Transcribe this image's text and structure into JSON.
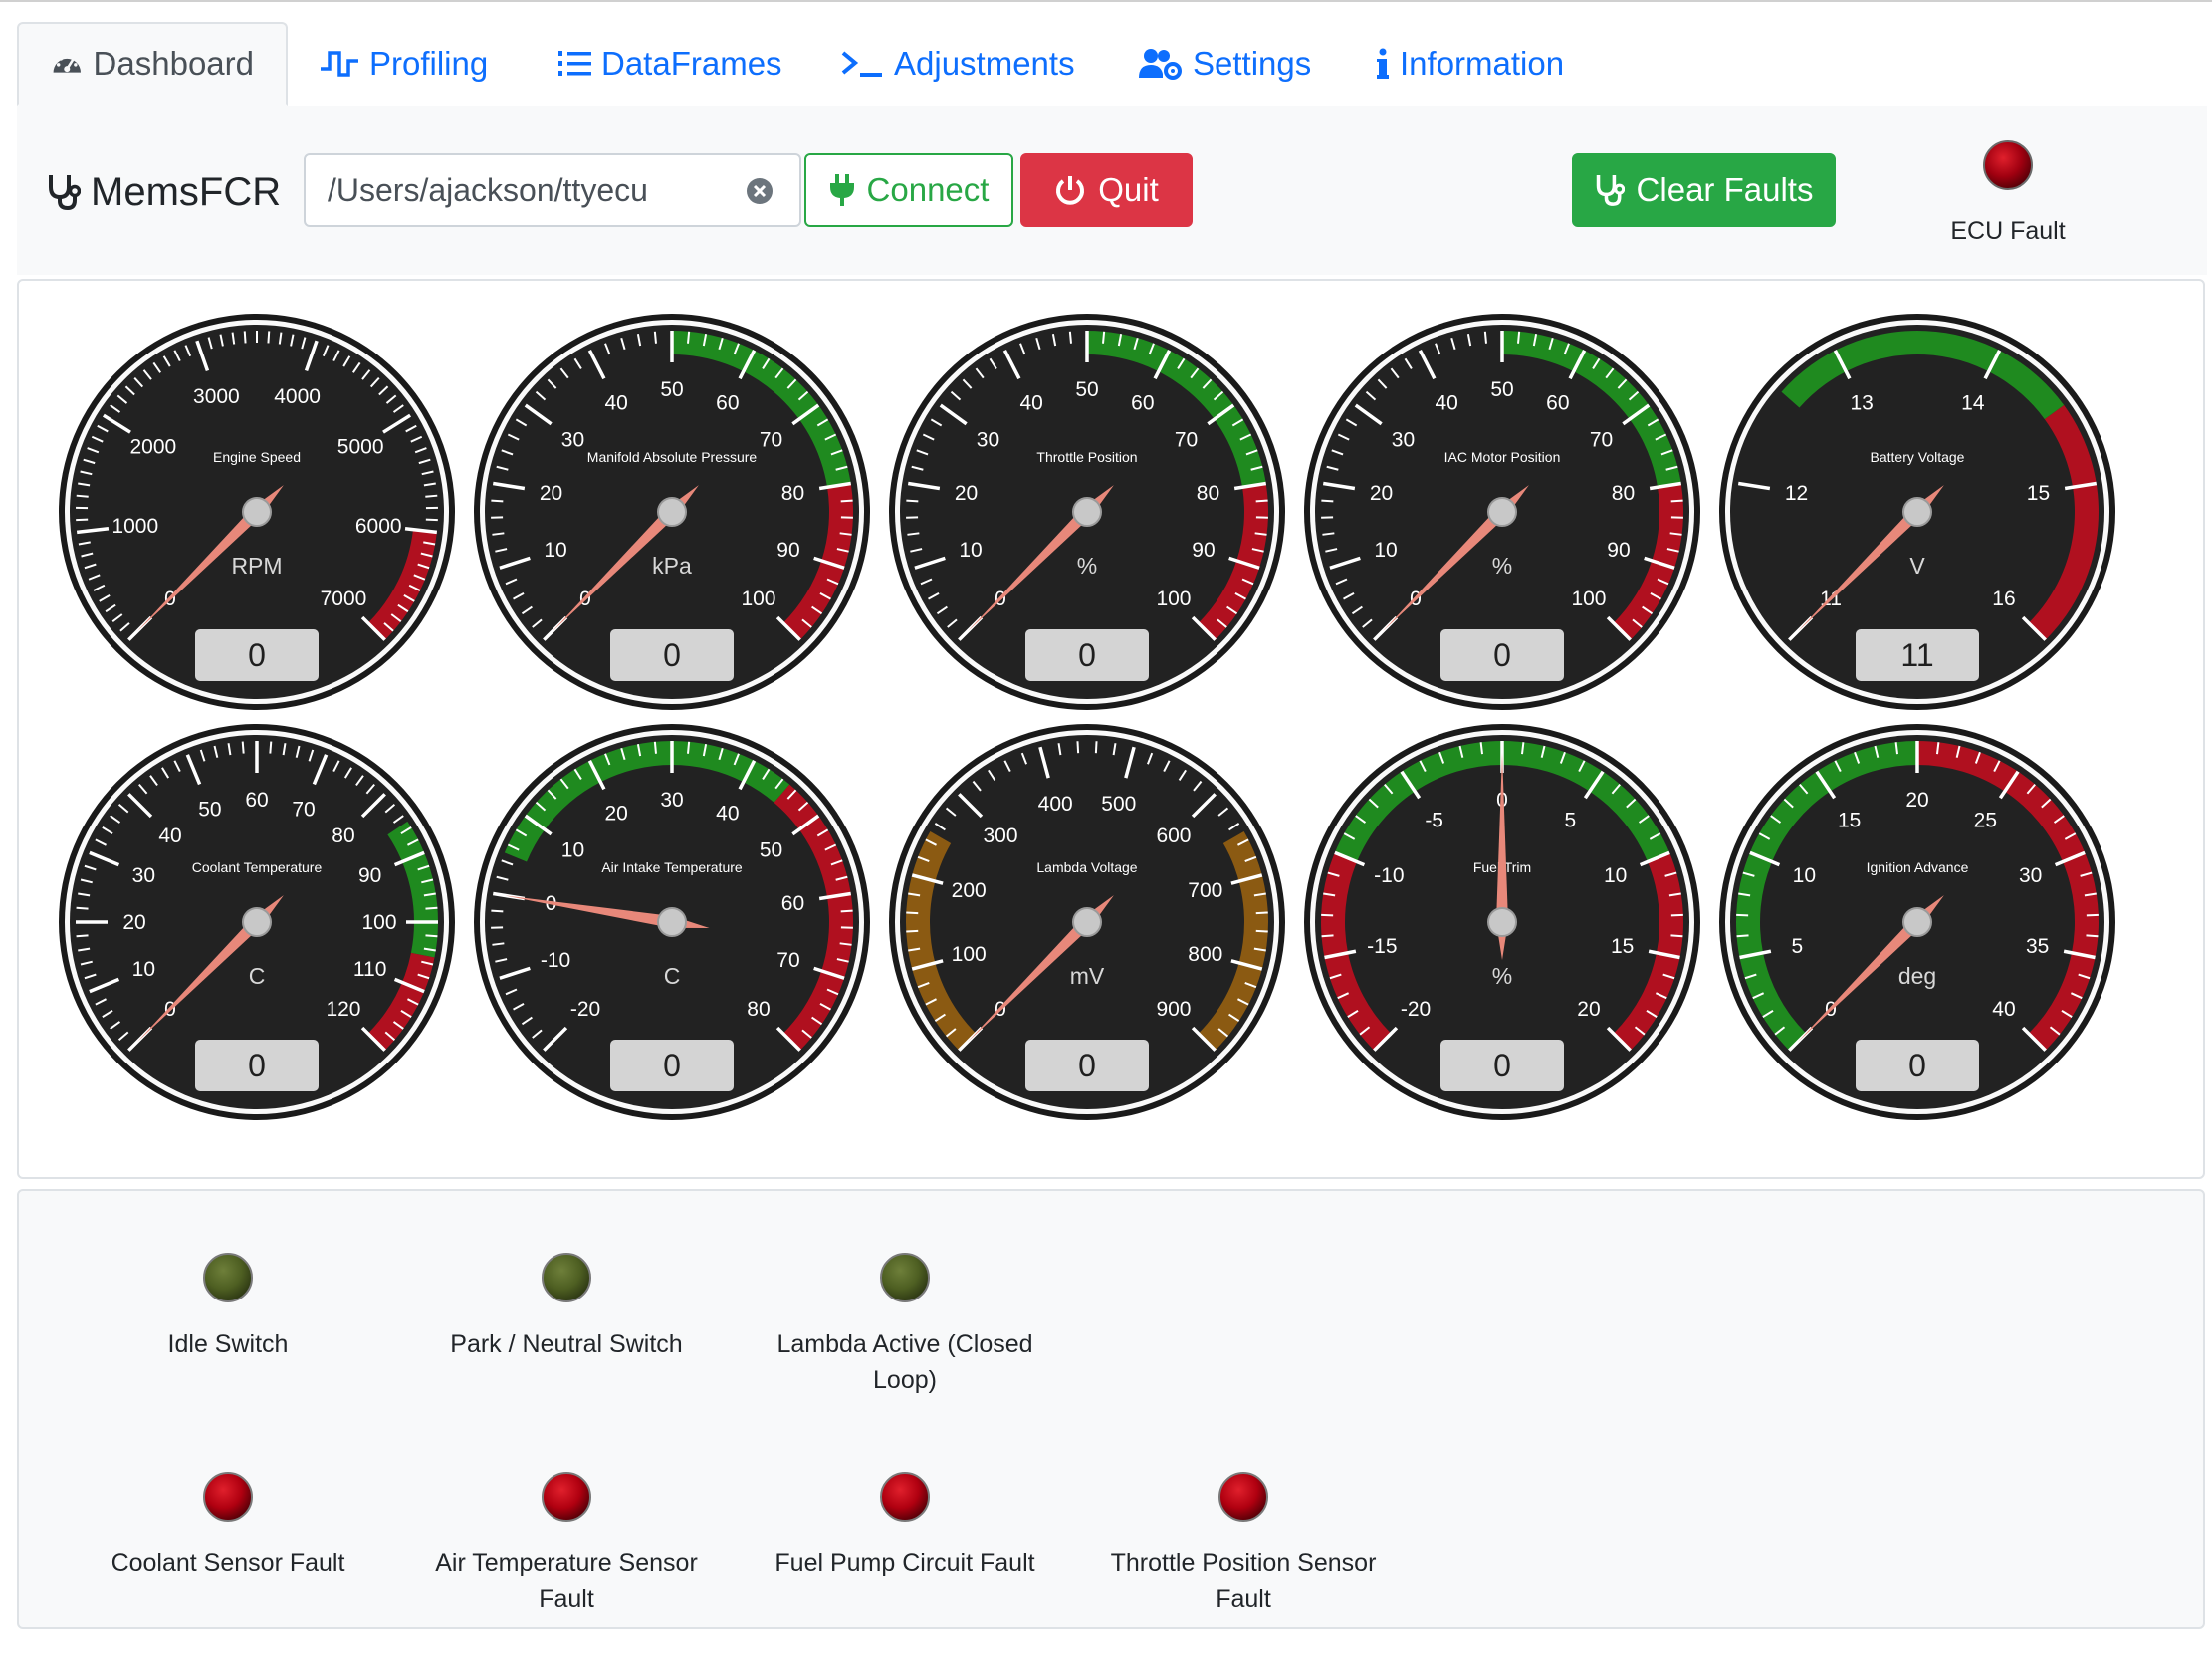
{
  "tabs": [
    {
      "label": "Dashboard",
      "icon": "speedometer-icon",
      "active": true
    },
    {
      "label": "Profiling",
      "icon": "pulse-icon",
      "active": false
    },
    {
      "label": "DataFrames",
      "icon": "list-ol-icon",
      "active": false
    },
    {
      "label": "Adjustments",
      "icon": "terminal-icon",
      "active": false
    },
    {
      "label": "Settings",
      "icon": "users-gear-icon",
      "active": false
    },
    {
      "label": "Information",
      "icon": "info-icon",
      "active": false
    }
  ],
  "toolbar": {
    "brand": "MemsFCR",
    "port_value": "/Users/ajackson/ttyecu",
    "connect_label": "Connect",
    "quit_label": "Quit",
    "clear_faults_label": "Clear Faults",
    "ecu_fault_label": "ECU Fault"
  },
  "colors": {
    "primary": "#0d6efd",
    "success": "#28a745",
    "danger": "#dc3545",
    "gauge_face": "#222222",
    "green_band": "#1f8a1f",
    "red_band": "#b0101f",
    "amber_band": "#8b5a12",
    "needle": "#e8887a",
    "led_red": "#b00010",
    "led_olive": "#4e5f22"
  },
  "gauges": [
    {
      "title": "Engine Speed",
      "unit": "RPM",
      "min": 0,
      "max": 7000,
      "value": 0,
      "display": "0",
      "labels": [
        "0",
        "1000",
        "2000",
        "3000",
        "4000",
        "5000",
        "6000",
        "7000"
      ],
      "minor": 10,
      "bands": [
        {
          "from": 6000,
          "to": 7000,
          "color": "red"
        }
      ]
    },
    {
      "title": "Manifold Absolute Pressure",
      "unit": "kPa",
      "min": 0,
      "max": 100,
      "value": 0,
      "display": "0",
      "labels": [
        "0",
        "10",
        "20",
        "30",
        "40",
        "50",
        "60",
        "70",
        "80",
        "90",
        "100"
      ],
      "minor": 5,
      "bands": [
        {
          "from": 50,
          "to": 80,
          "color": "green"
        },
        {
          "from": 80,
          "to": 100,
          "color": "red"
        }
      ]
    },
    {
      "title": "Throttle Position",
      "unit": "%",
      "min": 0,
      "max": 100,
      "value": 0,
      "display": "0",
      "labels": [
        "0",
        "10",
        "20",
        "30",
        "40",
        "50",
        "60",
        "70",
        "80",
        "90",
        "100"
      ],
      "minor": 5,
      "bands": [
        {
          "from": 50,
          "to": 80,
          "color": "green"
        },
        {
          "from": 80,
          "to": 100,
          "color": "red"
        }
      ]
    },
    {
      "title": "IAC Motor Position",
      "unit": "%",
      "min": 0,
      "max": 100,
      "value": 0,
      "display": "0",
      "labels": [
        "0",
        "10",
        "20",
        "30",
        "40",
        "50",
        "60",
        "70",
        "80",
        "90",
        "100"
      ],
      "minor": 5,
      "bands": [
        {
          "from": 50,
          "to": 80,
          "color": "green"
        },
        {
          "from": 80,
          "to": 100,
          "color": "red"
        }
      ]
    },
    {
      "title": "Battery Voltage",
      "unit": "V",
      "min": 11,
      "max": 16,
      "value": 11,
      "display": "11",
      "labels": [
        "11",
        "12",
        "13",
        "14",
        "15",
        "16"
      ],
      "minor": 0,
      "bands": [
        {
          "from": 12.6,
          "to": 14.5,
          "color": "green"
        },
        {
          "from": 14.5,
          "to": 16,
          "color": "red"
        }
      ]
    },
    {
      "title": "Coolant Temperature",
      "unit": "C",
      "min": 0,
      "max": 120,
      "value": 0,
      "display": "0",
      "labels": [
        "0",
        "10",
        "20",
        "30",
        "40",
        "50",
        "60",
        "70",
        "80",
        "90",
        "100",
        "110",
        "120"
      ],
      "minor": 5,
      "bands": [
        {
          "from": 85,
          "to": 105,
          "color": "green"
        },
        {
          "from": 105,
          "to": 120,
          "color": "red"
        }
      ]
    },
    {
      "title": "Air Intake Temperature",
      "unit": "C",
      "min": -20,
      "max": 80,
      "value": 0,
      "display": "0",
      "labels": [
        "-20",
        "-10",
        "0",
        "10",
        "20",
        "30",
        "40",
        "50",
        "60",
        "70",
        "80"
      ],
      "minor": 5,
      "bands": [
        {
          "from": 5,
          "to": 45,
          "color": "green"
        },
        {
          "from": 45,
          "to": 80,
          "color": "red"
        }
      ]
    },
    {
      "title": "Lambda Voltage",
      "unit": "mV",
      "min": 0,
      "max": 900,
      "value": 0,
      "display": "0",
      "labels": [
        "0",
        "100",
        "200",
        "300",
        "400",
        "500",
        "600",
        "700",
        "800",
        "900"
      ],
      "minor": 5,
      "bands": [
        {
          "from": 0,
          "to": 250,
          "color": "amber"
        },
        {
          "from": 650,
          "to": 900,
          "color": "amber"
        }
      ]
    },
    {
      "title": "Fuel Trim",
      "unit": "%",
      "min": -20,
      "max": 20,
      "value": 0,
      "display": "0",
      "labels": [
        "-20",
        "-15",
        "-10",
        "-5",
        "0",
        "5",
        "10",
        "15",
        "20"
      ],
      "minor": 5,
      "bands": [
        {
          "from": -20,
          "to": -10,
          "color": "red"
        },
        {
          "from": -10,
          "to": 10,
          "color": "green"
        },
        {
          "from": 10,
          "to": 20,
          "color": "red"
        }
      ]
    },
    {
      "title": "Ignition Advance",
      "unit": "deg",
      "min": 0,
      "max": 40,
      "value": 0,
      "display": "0",
      "labels": [
        "0",
        "5",
        "10",
        "15",
        "20",
        "25",
        "30",
        "35",
        "40"
      ],
      "minor": 5,
      "bands": [
        {
          "from": 0,
          "to": 20,
          "color": "green"
        },
        {
          "from": 20,
          "to": 40,
          "color": "red"
        }
      ]
    }
  ],
  "indicators": [
    {
      "label": "Idle Switch",
      "color": "olive"
    },
    {
      "label": "Park / Neutral Switch",
      "color": "olive"
    },
    {
      "label": "Lambda Active (Closed Loop)",
      "color": "olive"
    },
    {
      "label": "Coolant Sensor Fault",
      "color": "red"
    },
    {
      "label": "Air Temperature Sensor Fault",
      "color": "red"
    },
    {
      "label": "Fuel Pump Circuit Fault",
      "color": "red"
    },
    {
      "label": "Throttle Position Sensor Fault",
      "color": "red"
    }
  ]
}
